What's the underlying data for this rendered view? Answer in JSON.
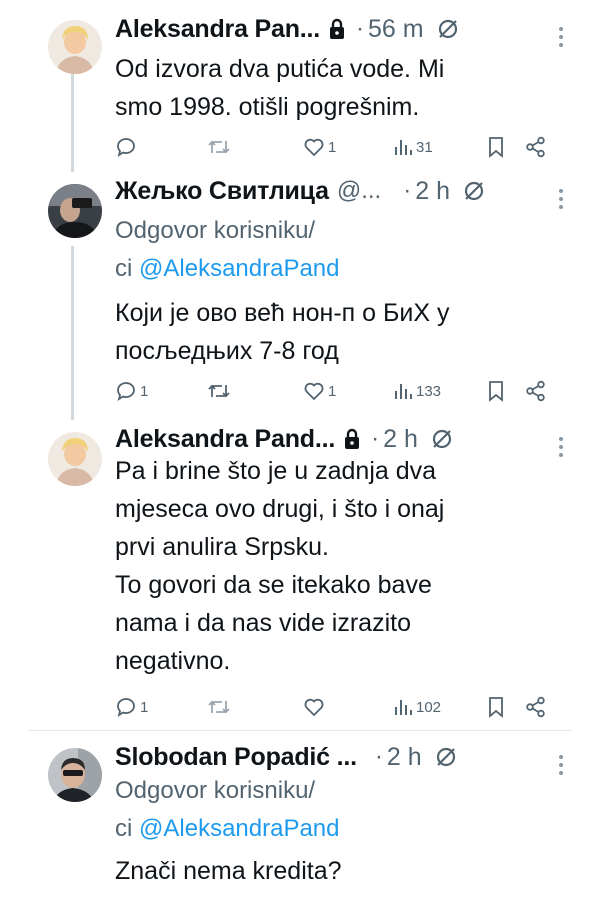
{
  "tweets": [
    {
      "author": "Aleksandra Pan...",
      "handle": "",
      "time": "56 m",
      "reply_prefix": "",
      "reply_mention": "",
      "reply_prefix2": "",
      "lines": [
        "Od izvora dva putića vode. Mi",
        "smo 1998. otišli pogrešnim."
      ],
      "replies": "",
      "reposts": "",
      "likes": "1",
      "views": "31"
    },
    {
      "author": "Жељко Свитлица",
      "handle": "@...",
      "time": "2 h",
      "reply_prefix": "Odgovor korisniku/",
      "reply_prefix2": "ci",
      "reply_mention": "@AleksandraPand",
      "lines": [
        "Који је ово већ нон-п о БиХ у",
        "посљедњих 7-8 год"
      ],
      "replies": "1",
      "reposts": "",
      "likes": "1",
      "views": "133"
    },
    {
      "author": "Aleksandra Pand...",
      "handle": "",
      "time": "2 h",
      "reply_prefix": "",
      "reply_mention": "",
      "reply_prefix2": "",
      "lines": [
        "Pa i brine što je u zadnja dva",
        "mjeseca ovo drugi, i što i onaj",
        "prvi anulira Srpsku.",
        "To govori da se itekako bave",
        "nama i da nas vide izrazito",
        "negativno."
      ],
      "replies": "1",
      "reposts": "",
      "likes": "",
      "views": "102"
    },
    {
      "author": "Slobodan Popadić ...",
      "handle": "",
      "time": "2 h",
      "reply_prefix": "Odgovor korisniku/",
      "reply_prefix2": "ci",
      "reply_mention": "@AleksandraPand",
      "lines": [
        "Znači nema kredita?"
      ]
    }
  ],
  "icons": {
    "lock": "lock-icon",
    "grok": "grok-icon",
    "more": "more-icon",
    "reply": "reply-icon",
    "repost": "repost-icon",
    "like": "like-icon",
    "views": "views-icon",
    "bookmark": "bookmark-icon",
    "share": "share-icon"
  },
  "colors": {
    "text": "#0f1419",
    "secondary": "#536471",
    "link": "#1d9bf0",
    "divider": "#e6e9ec",
    "thread_line": "#cfd9de"
  }
}
